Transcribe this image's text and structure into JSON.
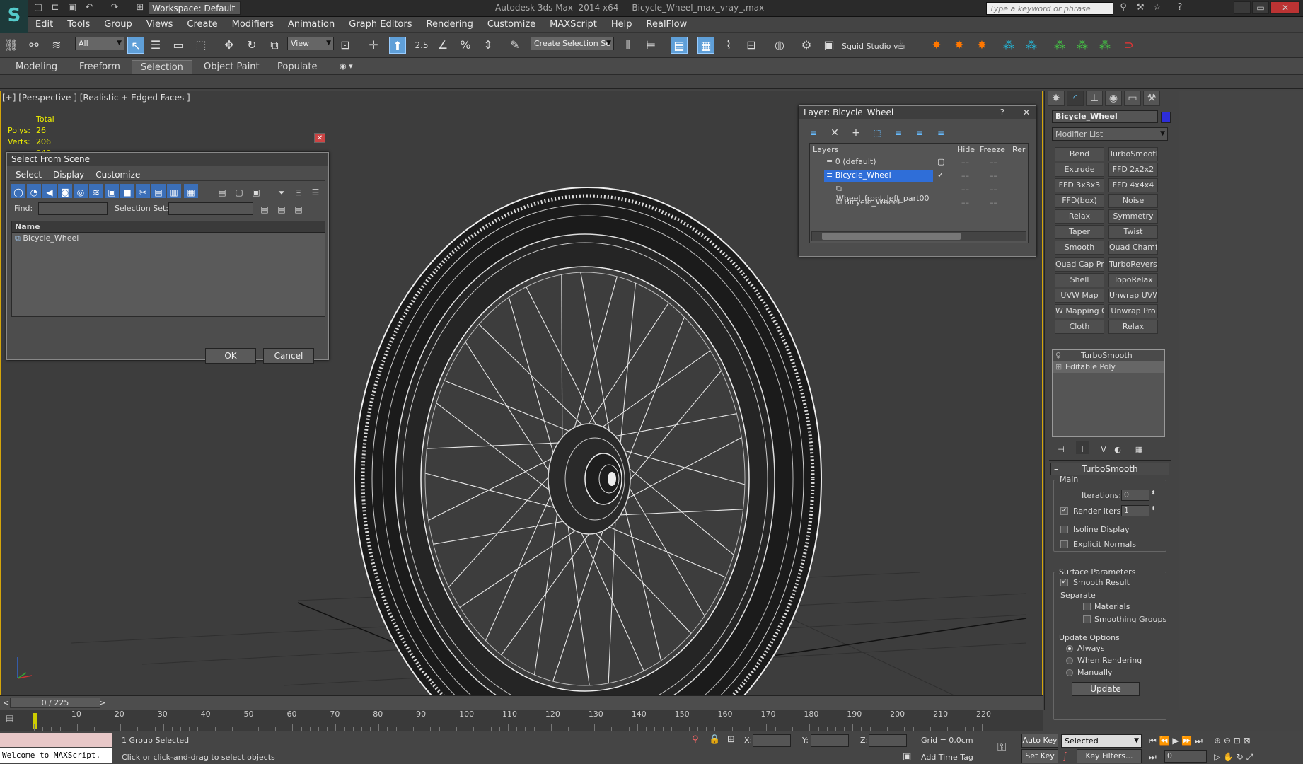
{
  "window": {
    "title": "Autodesk 3ds Max  2014 x64     Bicycle_Wheel_max_vray_.max",
    "workspace": "Workspace: Default",
    "search_placeholder": "Type a keyword or phrase"
  },
  "menu": [
    "Edit",
    "Tools",
    "Group",
    "Views",
    "Create",
    "Modifiers",
    "Animation",
    "Graph Editors",
    "Rendering",
    "Customize",
    "MAXScript",
    "Help",
    "RealFlow"
  ],
  "toolbar": {
    "filter": "All",
    "coord": "View",
    "snap_label": "2.5",
    "selection_set": "Create Selection Se",
    "studio": "Squid Studio v"
  },
  "ribbon": {
    "tabs": [
      "Modeling",
      "Freeform",
      "Selection",
      "Object Paint",
      "Populate"
    ],
    "active": "Selection"
  },
  "viewport": {
    "label": "[+] [Perspective ] [Realistic + Edged Faces ]",
    "stats": {
      "header": "Total",
      "polys_label": "Polys:",
      "polys": "26 206",
      "verts_label": "Verts:",
      "verts": "30 040"
    }
  },
  "select_dialog": {
    "title": "Select From Scene",
    "menu": [
      "Select",
      "Display",
      "Customize"
    ],
    "find_label": "Find:",
    "selset_label": "Selection Set:",
    "col_name": "Name",
    "items": [
      "Bicycle_Wheel"
    ],
    "ok": "OK",
    "cancel": "Cancel"
  },
  "layer_dialog": {
    "title": "Layer: Bicycle_Wheel",
    "cols": [
      "Layers",
      "Hide",
      "Freeze",
      "Rer"
    ],
    "rows": [
      {
        "name": "0 (default)",
        "indent": 0
      },
      {
        "name": "Bicycle_Wheel",
        "indent": 0
      },
      {
        "name": "Wheel_front_left_part00",
        "indent": 1
      },
      {
        "name": "Bicycle_Wheel",
        "indent": 1
      }
    ]
  },
  "cmd_panel": {
    "object_name": "Bicycle_Wheel",
    "object_color": "#2d2dd9",
    "modifier_list": "Modifier List",
    "buttons": [
      [
        "Bend",
        "TurboSmooth"
      ],
      [
        "Extrude",
        "FFD 2x2x2"
      ],
      [
        "FFD 3x3x3",
        "FFD 4x4x4"
      ],
      [
        "FFD(box)",
        "Noise"
      ],
      [
        "Relax",
        "Symmetry"
      ],
      [
        "Taper",
        "Twist"
      ],
      [
        "Smooth",
        "Quad Chamfer"
      ],
      [
        "Quad Cap Pro",
        "TurboReverse"
      ],
      [
        "Shell",
        "TopoRelax"
      ],
      [
        "UVW Map",
        "Unwrap UVW"
      ],
      [
        "W Mapping Cle",
        "Unwrap Pro"
      ],
      [
        "Cloth",
        "Relax"
      ]
    ],
    "stack": [
      "TurboSmooth",
      "Editable Poly"
    ],
    "rollout": "TurboSmooth",
    "main_label": "Main",
    "iterations_label": "Iterations:",
    "iterations": "0",
    "render_iters_label": "Render Iters:",
    "render_iters": "1",
    "isoline": "Isoline Display",
    "explicit": "Explicit Normals",
    "surface_label": "Surface Parameters",
    "smooth_result": "Smooth Result",
    "separate": "Separate",
    "materials": "Materials",
    "smoothing_groups": "Smoothing Groups",
    "update_label": "Update Options",
    "always": "Always",
    "when_rendering": "When Rendering",
    "manually": "Manually",
    "update": "Update"
  },
  "timeline": {
    "frame": "0 / 225",
    "ticks": [
      10,
      20,
      30,
      40,
      50,
      60,
      70,
      80,
      90,
      100,
      110,
      120,
      130,
      140,
      150,
      160,
      170,
      180,
      190,
      200,
      210,
      220
    ]
  },
  "status": {
    "maxscript": "Welcome to MAXScript.",
    "selected": "1 Group Selected",
    "prompt": "Click or click-and-drag to select objects",
    "x_label": "X:",
    "y_label": "Y:",
    "z_label": "Z:",
    "grid": "Grid = 0,0cm",
    "add_time_tag": "Add Time Tag",
    "auto_key": "Auto Key",
    "set_key": "Set Key",
    "key_mode": "Selected",
    "key_filters": "Key Filters...",
    "frame_value": "0"
  }
}
